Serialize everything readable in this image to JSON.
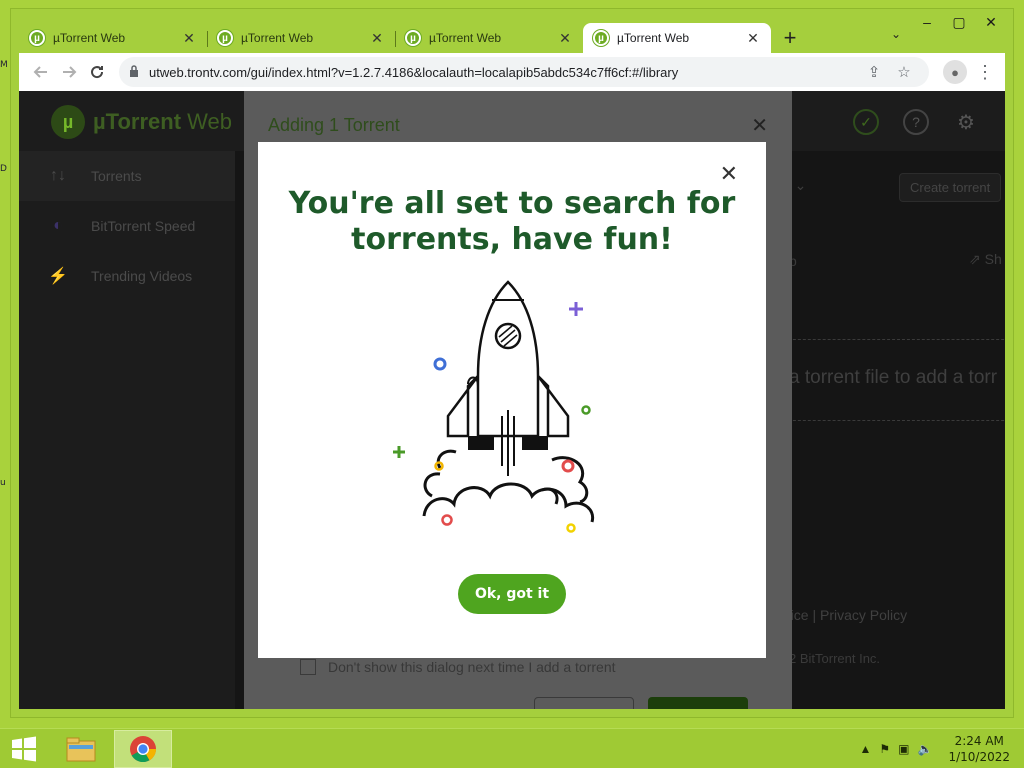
{
  "desktop": {
    "edge_labels": [
      "M",
      "D",
      "u"
    ]
  },
  "browser": {
    "tabs": [
      {
        "title": "µTorrent Web",
        "active": false
      },
      {
        "title": "µTorrent Web",
        "active": false
      },
      {
        "title": "µTorrent Web",
        "active": false
      },
      {
        "title": "µTorrent Web",
        "active": true
      }
    ],
    "tab_close": "✕",
    "new_tab": "+",
    "tab_menu": "⌄",
    "url": "utweb.trontv.com/gui/index.html?v=1.2.7.4186&localauth=localapib5abdc534c7ff6cf:#/library",
    "window_buttons": {
      "minimize": "–",
      "maximize": "▢",
      "close": "✕"
    }
  },
  "app": {
    "logo_text_bold": "µTorrent",
    "logo_text": " Web",
    "sidebar": [
      {
        "label": "Torrents",
        "icon": "↑↓"
      },
      {
        "label": "BitTorrent Speed",
        "icon": "◐"
      },
      {
        "label": "Trending Videos",
        "icon": "⚡"
      }
    ],
    "background": {
      "dropdown": "nt ⌄",
      "create_button": "Create torrent",
      "share": "⇗ Sh",
      "p_char": "p",
      "drop_text": "a torrent file to add a torr",
      "footer": "rvice  |  Privacy Policy",
      "copyright": "2 BitTorrent Inc."
    }
  },
  "add_dialog": {
    "title": "Adding 1 Torrent",
    "close": "✕",
    "dont_show": "Don't show this dialog next time I add a torrent"
  },
  "modal": {
    "title_line1": "You're all set to search for",
    "title_line2": "torrents, have fun!",
    "close": "✕",
    "ok_button": "Ok, got it"
  },
  "taskbar": {
    "time": "2:24 AM",
    "date": "1/10/2022"
  },
  "colors": {
    "accent_green": "#4fa51f",
    "title_green": "#1e5a2a",
    "desktop_green": "#a9d23c"
  }
}
